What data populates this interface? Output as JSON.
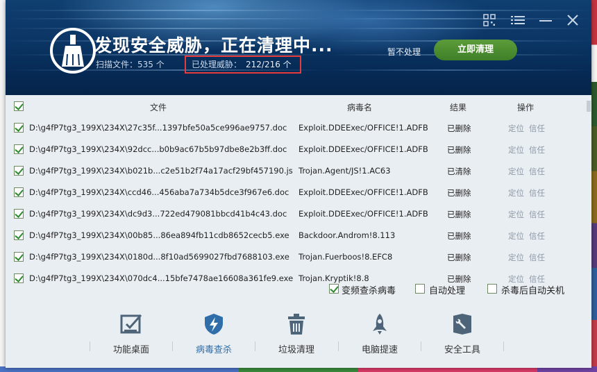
{
  "header": {
    "title": "发现安全威胁，正在清理中...",
    "scan_label": "扫描文件：535 个",
    "threat_label": "已处理威胁：",
    "threat_value": "212/216 个",
    "skip": "暂不处理",
    "clean_now": "立即清理"
  },
  "table": {
    "col_file": "文件",
    "col_virus": "病毒名",
    "col_result": "结果",
    "col_action": "操作",
    "rows": [
      {
        "file": "D:\\g4fP7tg3_199X\\234X\\27c35f...1397bfe50a5ce996ae9757.doc",
        "virus": "Exploit.DDEExec/OFFICE!1.ADFB",
        "result": "已删除",
        "locate": "定位",
        "trust": "信任"
      },
      {
        "file": "D:\\g4fP7tg3_199X\\234X\\92dcc...b0b9ac67b5b97dbe8e2b3ff.doc",
        "virus": "Exploit.DDEExec/OFFICE!1.ADFB",
        "result": "已删除",
        "locate": "定位",
        "trust": "信任"
      },
      {
        "file": "D:\\g4fP7tg3_199X\\234X\\b021b...c2e51b2f74a17acf29bf457190.js",
        "virus": "Trojan.Agent/JS!1.AC63",
        "result": "已清除",
        "locate": "定位",
        "trust": "信任"
      },
      {
        "file": "D:\\g4fP7tg3_199X\\234X\\ccd46...456aba7a734b5dce3f967e6.doc",
        "virus": "Exploit.DDEExec/OFFICE!1.ADFB",
        "result": "已删除",
        "locate": "定位",
        "trust": "信任"
      },
      {
        "file": "D:\\g4fP7tg3_199X\\234X\\dc9d3...722ed479081bbcd41b4c43.doc",
        "virus": "Exploit.DDEExec/OFFICE!1.ADFB",
        "result": "已删除",
        "locate": "定位",
        "trust": "信任"
      },
      {
        "file": "D:\\g4fP7tg3_199X\\234X\\00b85...86ea894fb11cdb8652cecb5.exe",
        "virus": "Backdoor.Androm!8.113",
        "result": "已删除",
        "locate": "定位",
        "trust": "信任"
      },
      {
        "file": "D:\\g4fP7tg3_199X\\234X\\0180d...8f10ad5699027fbd7688103.exe",
        "virus": "Trojan.Fuerboos!8.EFC8",
        "result": "已删除",
        "locate": "定位",
        "trust": "信任"
      },
      {
        "file": "D:\\g4fP7tg3_199X\\234X\\070dc4...15bfe7478ae16608a361fe9.exe",
        "virus": "Trojan.Kryptik!8.8",
        "result": "已删除",
        "locate": "定位",
        "trust": "信任"
      }
    ]
  },
  "options": {
    "variant": "变频查杀病毒",
    "auto_handle": "自动处理",
    "auto_shutdown": "杀毒后自动关机"
  },
  "toolbar": {
    "items": [
      {
        "label": "功能桌面",
        "icon": "chart-check-icon"
      },
      {
        "label": "病毒查杀",
        "icon": "shield-bolt-icon"
      },
      {
        "label": "垃圾清理",
        "icon": "trash-icon"
      },
      {
        "label": "电脑提速",
        "icon": "rocket-icon"
      },
      {
        "label": "安全工具",
        "icon": "toolbox-icon"
      }
    ]
  },
  "colors": {
    "accent_green": "#4b8c30",
    "active_blue": "#2f6ea8",
    "highlight_red": "#e53b3b"
  }
}
